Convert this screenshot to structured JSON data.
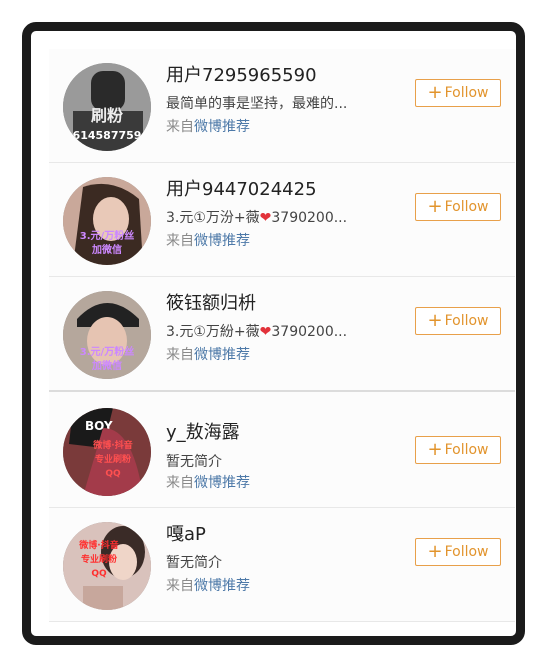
{
  "follow_label": "Follow",
  "source_prefix": "来自",
  "source_link": "微博推荐",
  "users": [
    {
      "name": "用户7295965590",
      "bio": "最简单的事是坚持，最难的...",
      "avatar_text": "刷粉 614587759"
    },
    {
      "name": "用户9447024425",
      "bio_pre": "3.元①万汾+薇",
      "bio_post": "3790200...",
      "avatar_text": "3.元/万粉丝 加微信"
    },
    {
      "name": "筱钰额归枡",
      "bio_pre": "3.元①万紛+薇",
      "bio_post": "3790200...",
      "avatar_text": "3.元/万粉丝 加微信"
    },
    {
      "name": "y_敖海露",
      "bio": "暂无简介",
      "avatar_text": "BOY 微博·抖音 专业刷粉 QQ"
    },
    {
      "name": "嘎aP",
      "bio": "暂无简介",
      "avatar_text": "微博·抖音 专业刷粉 QQ"
    }
  ],
  "colors": {
    "accent": "#e2942d",
    "link": "#4d79a8",
    "heart": "#e2323a"
  }
}
